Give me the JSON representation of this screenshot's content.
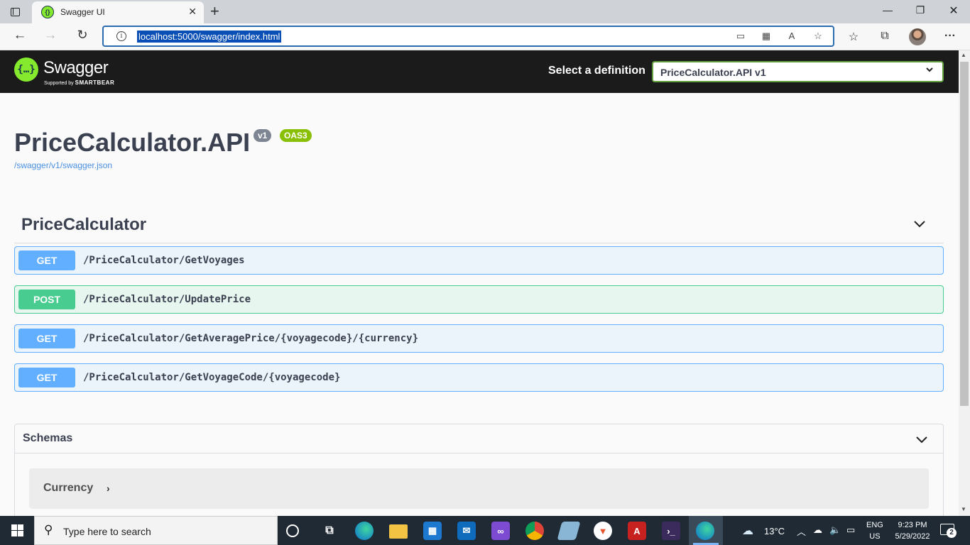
{
  "browser": {
    "tab_title": "Swagger UI",
    "url": "localhost:5000/swagger/index.html"
  },
  "swagger": {
    "logo_text": "Swagger",
    "logo_sub_prefix": "Supported by",
    "logo_sub_brand": "SMARTBEAR",
    "select_label": "Select a definition",
    "selected_definition": "PriceCalculator.API v1"
  },
  "info": {
    "title": "PriceCalculator.API",
    "version": "v1",
    "oas": "OAS3",
    "spec_url": "/swagger/v1/swagger.json"
  },
  "tag": {
    "name": "PriceCalculator",
    "operations": [
      {
        "method": "GET",
        "path": "/PriceCalculator/GetVoyages"
      },
      {
        "method": "POST",
        "path": "/PriceCalculator/UpdatePrice"
      },
      {
        "method": "GET",
        "path": "/PriceCalculator/GetAveragePrice/{voyagecode}/{currency}"
      },
      {
        "method": "GET",
        "path": "/PriceCalculator/GetVoyageCode/{voyagecode}"
      }
    ]
  },
  "schemas": {
    "title": "Schemas",
    "models": [
      {
        "name": "Currency"
      }
    ]
  },
  "taskbar": {
    "search_placeholder": "Type here to search",
    "weather": "13°C",
    "lang_line1": "ENG",
    "lang_line2": "US",
    "time": "9:23 PM",
    "date": "5/29/2022",
    "notification_count": "2"
  },
  "colors": {
    "get": "#61affe",
    "post": "#49cc90",
    "topbar": "#1b1b1b",
    "swagger_green": "#85ea2d"
  }
}
